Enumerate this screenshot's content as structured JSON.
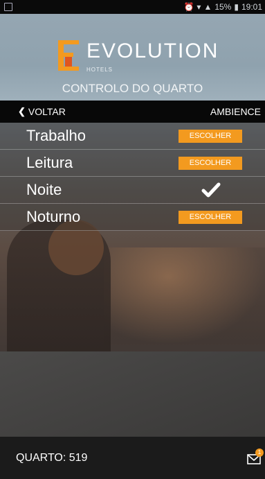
{
  "status_bar": {
    "battery": "15%",
    "time": "19:01"
  },
  "header": {
    "brand": "EVOLUTION",
    "brand_sub": "HOTELS",
    "subtitle": "CONTROLO DO QUARTO"
  },
  "nav": {
    "back_label": "VOLTAR",
    "section_label": "AMBIENCE"
  },
  "ambience_items": [
    {
      "label": "Trabalho",
      "action_label": "ESCOLHER",
      "selected": false
    },
    {
      "label": "Leitura",
      "action_label": "ESCOLHER",
      "selected": false
    },
    {
      "label": "Noite",
      "action_label": "",
      "selected": true
    },
    {
      "label": "Noturno",
      "action_label": "ESCOLHER",
      "selected": false
    }
  ],
  "footer": {
    "room_label": "QUARTO: 519",
    "mail_badge": "1"
  },
  "colors": {
    "accent": "#f39a1f",
    "header_bg": "#95a6b2",
    "bar_bg": "#080808"
  }
}
